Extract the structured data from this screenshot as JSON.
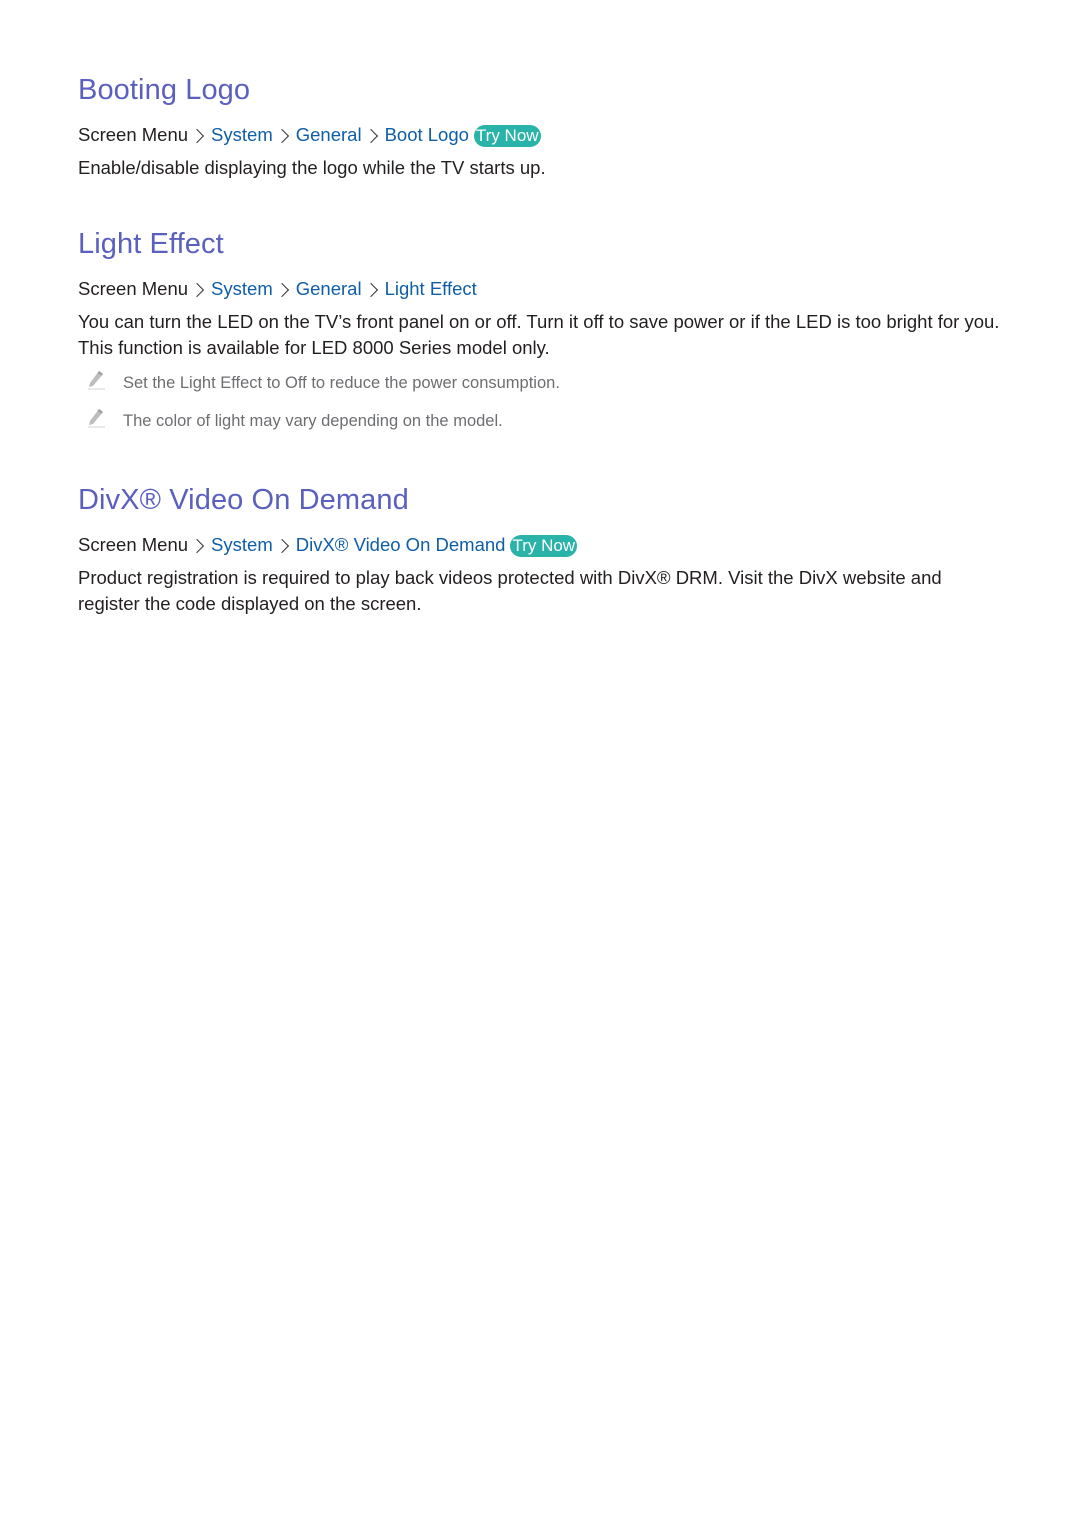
{
  "sections": [
    {
      "title": "Booting Logo",
      "breadcrumb": {
        "root": "Screen Menu",
        "items": [
          "System",
          "General",
          "Boot Logo"
        ],
        "try_now": "Try Now"
      },
      "paragraphs": [
        "Enable/disable displaying the logo while the TV starts up."
      ],
      "notes": []
    },
    {
      "title": "Light Effect",
      "breadcrumb": {
        "root": "Screen Menu",
        "items": [
          "System",
          "General",
          "Light Effect"
        ],
        "try_now": ""
      },
      "paragraphs": [
        "You can turn the LED on the TV’s front panel on or off. Turn it off to save power or if the LED is too bright for you. This function is available for LED 8000 Series model only."
      ],
      "notes": [
        "Set the Light Effect to Off to reduce the power consumption.",
        "The color of light may vary depending on the model."
      ]
    },
    {
      "title": "DivX® Video On Demand",
      "breadcrumb": {
        "root": "Screen Menu",
        "items": [
          "System",
          "DivX® Video On Demand"
        ],
        "try_now": "Try Now"
      },
      "paragraphs": [
        "Product registration is required to play back videos protected with DivX® DRM. Visit the DivX website and register the code displayed on the screen."
      ],
      "notes": []
    }
  ],
  "colors": {
    "heading": "#5b5fbe",
    "link": "#0f5ea8",
    "try_now_bg": "#2ab3a8",
    "body_text": "#231f20",
    "note_text": "#6d6e71"
  },
  "icons": {
    "note": "pencil-icon",
    "separator": "chevron-right-icon"
  }
}
